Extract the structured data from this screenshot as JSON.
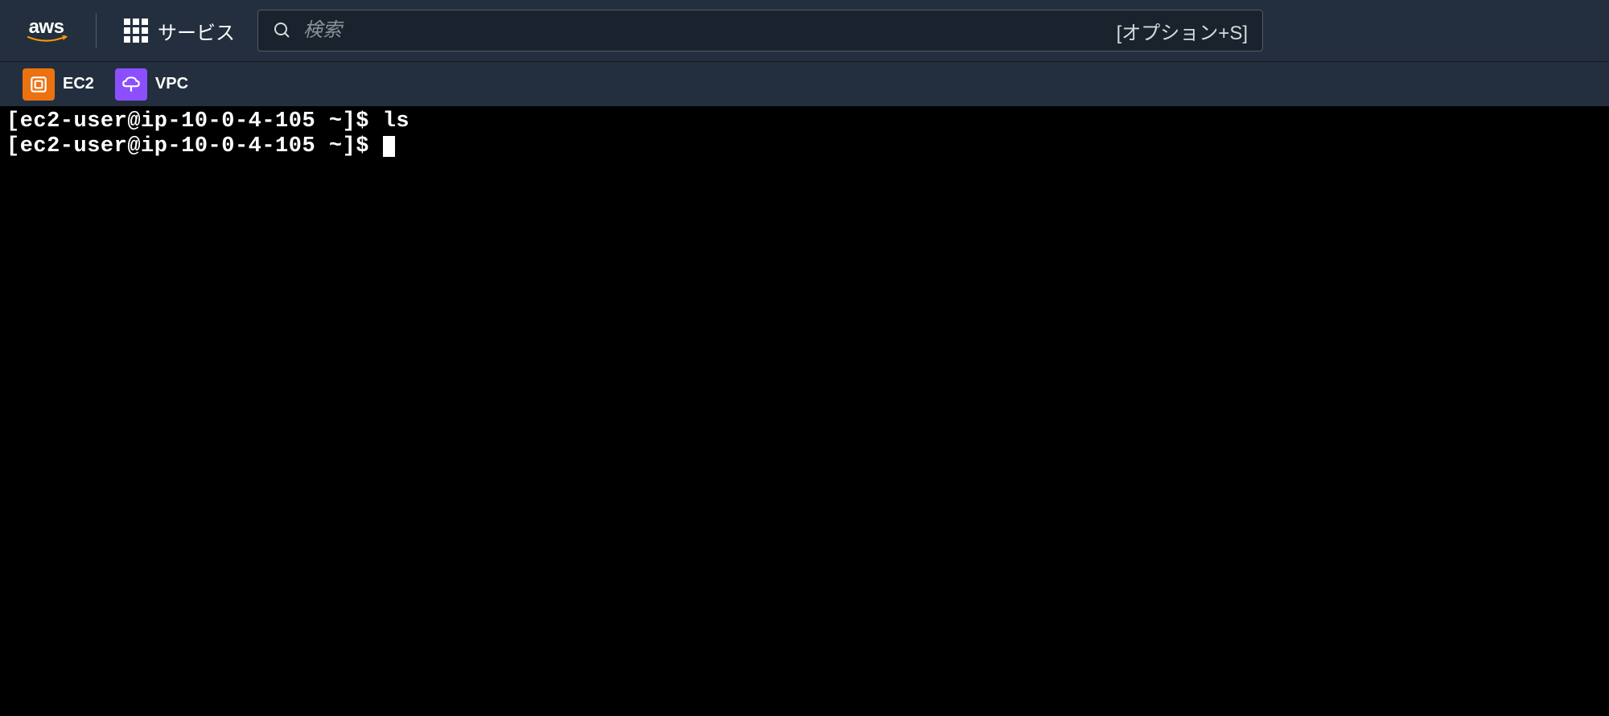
{
  "header": {
    "logo_text": "aws",
    "services_label": "サービス",
    "search": {
      "placeholder": "検索",
      "hint": "[オプション+S]"
    }
  },
  "subnav": {
    "items": [
      {
        "label": "EC2",
        "icon": "ec2-icon"
      },
      {
        "label": "VPC",
        "icon": "vpc-icon"
      }
    ]
  },
  "terminal": {
    "lines": [
      {
        "prompt": "[ec2-user@ip-10-0-4-105 ~]$ ",
        "command": "ls"
      },
      {
        "prompt": "[ec2-user@ip-10-0-4-105 ~]$ ",
        "command": ""
      }
    ]
  }
}
